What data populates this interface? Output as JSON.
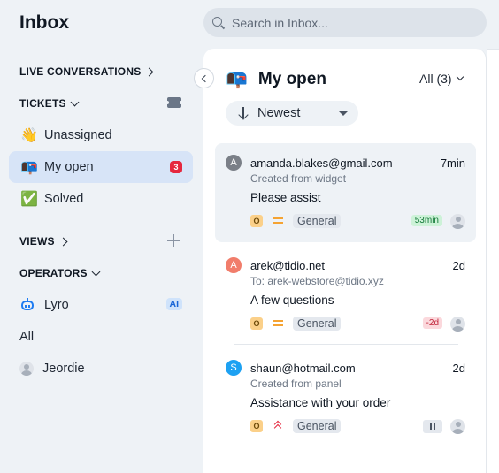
{
  "sidebar": {
    "title": "Inbox",
    "live_conversations": "LIVE CONVERSATIONS",
    "tickets": "TICKETS",
    "views": "VIEWS",
    "operators": "OPERATORS",
    "items": [
      {
        "emoji": "👋",
        "label": "Unassigned"
      },
      {
        "emoji": "📭",
        "label": "My open",
        "count": "3",
        "active": true
      },
      {
        "emoji": "✅",
        "label": "Solved"
      }
    ],
    "operator_items": [
      {
        "label": "Lyro",
        "badge": "AI",
        "icon": "robot-icon"
      },
      {
        "label": "All"
      },
      {
        "label": "Jeordie",
        "icon": "user-avatar"
      }
    ]
  },
  "search": {
    "placeholder": "Search in Inbox..."
  },
  "panel": {
    "emoji": "📭",
    "title": "My open",
    "filter": "All (3)",
    "sort": "Newest"
  },
  "conversations": [
    {
      "initial": "A",
      "avatar_color": "#7a7f87",
      "email": "amanda.blakes@gmail.com",
      "time": "7min",
      "sub": "Created from widget",
      "subject": "Please assist",
      "status": "O",
      "priority": "medium",
      "tag": "General",
      "sla": "53min",
      "sla_kind": "green",
      "selected": true
    },
    {
      "initial": "A",
      "avatar_color": "#f17d6b",
      "email": "arek@tidio.net",
      "time": "2d",
      "sub": "To: arek-webstore@tidio.xyz",
      "subject": "A few questions",
      "status": "O",
      "priority": "medium",
      "tag": "General",
      "sla": "-2d",
      "sla_kind": "red"
    },
    {
      "initial": "S",
      "avatar_color": "#1da1f2",
      "email": "shaun@hotmail.com",
      "time": "2d",
      "sub": "Created from panel",
      "subject": "Assistance with your order",
      "status": "O",
      "priority": "high",
      "tag": "General",
      "sla_kind": "paused"
    }
  ],
  "colors": {
    "accent": "#1764d6",
    "active_bg": "#d7e4f7",
    "badge_red": "#e5273e"
  }
}
